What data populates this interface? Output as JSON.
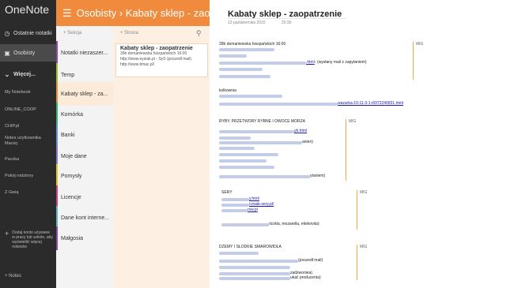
{
  "app": {
    "title": "OneNote"
  },
  "left": {
    "recent": "Ostatnie notatki",
    "personal": "Osobisty",
    "more": "Więcej...",
    "notebooks": [
      "My Notebook",
      "ONLINE_COOP",
      "CHIP.pl",
      "Notes użytkownika Maciej",
      "Paczka",
      "Pokój rodzinny",
      "Z Gwią"
    ],
    "tip": "Dodaj konto używane w pracy lub szkole, aby wyświetlić więcej notesów",
    "notes": "Notes"
  },
  "header": {
    "breadcrumb": "Osobisty › Kabaty sklep - zao..."
  },
  "sections": {
    "add_label": "Sekcja",
    "items": [
      "Notatki niezaszer...",
      "Temp",
      "Kabaty sklep - za...",
      "Komórka",
      "Banki",
      "Moje dane",
      "Pomysły",
      "Licencje",
      "Dane kont interne...",
      "Małgosia"
    ],
    "colors": [
      "#8e44ad",
      "#9bbf2c",
      "#f08a3c",
      "#2bb673",
      "#5b9bd5",
      "#7e7ed8",
      "#e6c117",
      "#d23c7a",
      "#5bb5c1",
      "#8e44ad"
    ]
  },
  "pages": {
    "add_label": "Strona",
    "card": {
      "title": "Kabaty sklep - zaopatrzenie",
      "line1": "39b domaniewska hiszpańskich 16:00",
      "line2": "http://www.eysiak.pl - SyS (poszedł mail)",
      "line3": "http://www.timac.pl/"
    }
  },
  "note": {
    "title": "Kabaty sklep - zaopatrzenie",
    "date": "12 października 2015",
    "time": "20:30",
    "l1": "39b domaniewska hiszpańskich 16:00",
    "l2": ".html",
    "l2b": " - (wysłany mail z zapytaniem)",
    "kolkownia": "kolkownia",
    "link2": "wazarka-10-11-3-1-i6972240831.html",
    "ryby": "RYBY, PRZETWORY RYBNE I OWOCE MORZA",
    "ryby_link": "yb.html",
    "anien": "anien)",
    "ytaniem": "ytaniem)",
    "sery": "SERY",
    "sery1": "y.html",
    "sery2": "czwak-sery.pl/",
    "sery3": "rsw.pl",
    "ricotta": "ricotta, mozarella, mlekovita)",
    "dzemy": "DŻEMY I SŁODKIE SMAROWIDŁA",
    "poszedl": "(poszedł mail)",
    "zadz": "zadzwoniea)",
    "producent": "ukać producenta)",
    "tag": "MIG"
  }
}
